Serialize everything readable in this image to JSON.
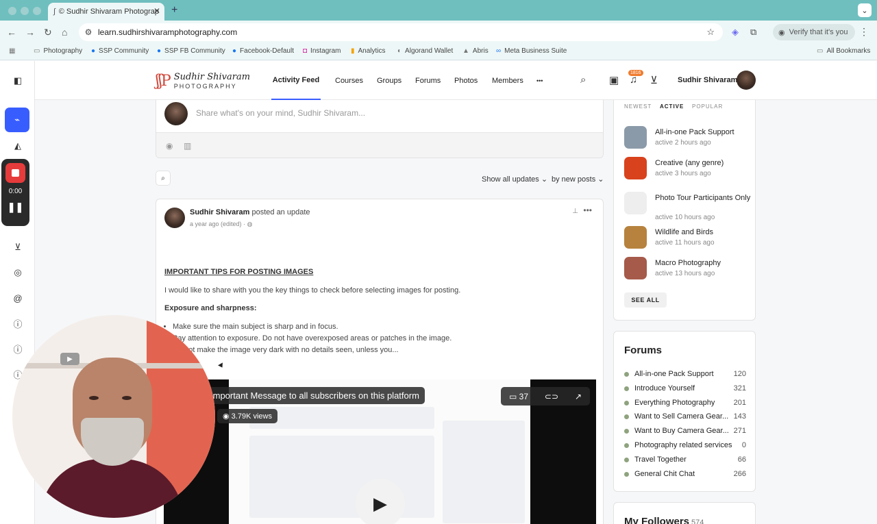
{
  "browser": {
    "tab_title": "© Sudhir Shivaram Photograp",
    "url": "learn.sudhirshivaramphotography.com",
    "verify_label": "Verify that it's you",
    "bookmarks": [
      "Photography",
      "SSP Community",
      "SSP FB Community",
      "Facebook-Default",
      "Instagram",
      "Analytics",
      "Algorand Wallet",
      "Abris",
      "Meta Business Suite"
    ],
    "all_bookmarks": "All Bookmarks"
  },
  "recorder": {
    "time": "0:00"
  },
  "header": {
    "logo_script": "Sudhir Shivaram",
    "logo_sub": "PHOTOGRAPHY",
    "nav": [
      "Activity Feed",
      "Courses",
      "Groups",
      "Forums",
      "Photos",
      "Members"
    ],
    "more": "•••",
    "notif_count": "1816",
    "user_name": "Sudhir Shivaram"
  },
  "composer": {
    "placeholder": "Share what's on your mind, Sudhir Shivaram..."
  },
  "filters": {
    "show": "Show all updates",
    "sort": "by new posts"
  },
  "post": {
    "author": "Sudhir Shivaram",
    "action": "posted an update",
    "meta": "a year ago (edited)  ·",
    "heading": "IMPORTANT TIPS FOR POSTING IMAGES",
    "intro": "I would like to share with you the key things to check before selecting images for posting.",
    "subheading": "Exposure and sharpness:",
    "bullets": [
      "Make sure the main subject is sharp and in focus.",
      "Pay attention to exposure. Do not have overexposed areas or patches in the image.",
      "Do not make the image very dark with no details seen, unless you..."
    ],
    "video": {
      "title": "Important Message to all subscribers on this platform",
      "views": "3.79K views",
      "comments": "37"
    }
  },
  "groups_widget": {
    "tabs": [
      "NEWEST",
      "ACTIVE",
      "POPULAR"
    ],
    "items": [
      {
        "name": "All-in-one Pack Support",
        "active": "active 2 hours ago",
        "color": "#8b9aa8"
      },
      {
        "name": "Creative (any genre)",
        "active": "active 3 hours ago",
        "color": "#d8421c"
      },
      {
        "name": "Photo Tour Participants Only",
        "active": "active 10 hours ago",
        "color": "#eeeeee"
      },
      {
        "name": "Wildlife and Birds",
        "active": "active 11 hours ago",
        "color": "#b6823e"
      },
      {
        "name": "Macro Photography",
        "active": "active 13 hours ago",
        "color": "#a65a4a"
      }
    ],
    "see_all": "SEE ALL"
  },
  "forums_widget": {
    "title": "Forums",
    "items": [
      {
        "name": "All-in-one Pack Support",
        "count": "120"
      },
      {
        "name": "Introduce Yourself",
        "count": "321"
      },
      {
        "name": "Everything Photography",
        "count": "201"
      },
      {
        "name": "Want to Sell Camera Gear...",
        "count": "143"
      },
      {
        "name": "Want to Buy Camera Gear...",
        "count": "271"
      },
      {
        "name": "Photography related services",
        "count": "0"
      },
      {
        "name": "Travel Together",
        "count": "66"
      },
      {
        "name": "General Chit Chat",
        "count": "266"
      }
    ]
  },
  "followers_widget": {
    "title": "My Followers",
    "count": "574"
  }
}
